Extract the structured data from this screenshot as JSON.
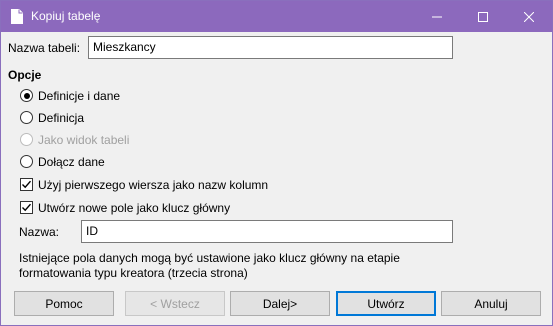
{
  "window": {
    "title": "Kopiuj tabelę"
  },
  "form": {
    "table_name_label": "Nazwa tabeli:",
    "table_name_value": "Mieszkancy",
    "options_heading": "Opcje",
    "radios": [
      {
        "label": "Definicje i dane",
        "checked": true,
        "disabled": false
      },
      {
        "label": "Definicja",
        "checked": false,
        "disabled": false
      },
      {
        "label": "Jako widok tabeli",
        "checked": false,
        "disabled": true
      },
      {
        "label": "Dołącz dane",
        "checked": false,
        "disabled": false
      }
    ],
    "checkboxes": [
      {
        "label": "Użyj pierwszego wiersza jako nazw kolumn",
        "checked": true
      },
      {
        "label": "Utwórz nowe pole jako klucz główny",
        "checked": true
      }
    ],
    "key_name_label": "Nazwa:",
    "key_name_value": "ID",
    "info_text_line1": "Istniejące pola danych mogą być ustawione jako klucz główny na etapie",
    "info_text_line2": "formatowania typu kreatora (trzecia strona)"
  },
  "buttons": {
    "help": "Pomoc",
    "back": "< Wstecz",
    "next": "Dalej>",
    "create": "Utwórz",
    "cancel": "Anuluj"
  },
  "colors": {
    "titlebar": "#8c69bd",
    "default_button_border": "#0078d7"
  }
}
